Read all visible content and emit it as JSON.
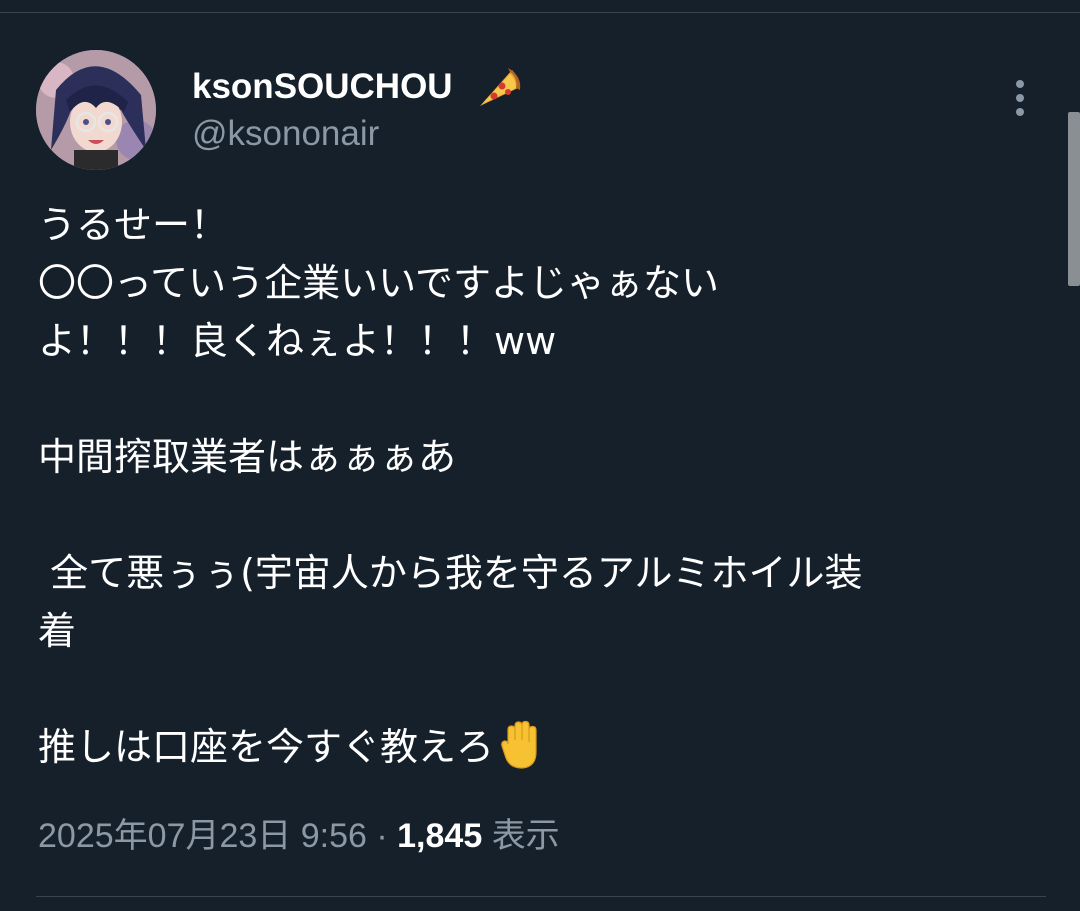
{
  "author": {
    "display_name": "ksonSOUCHOU",
    "handle": "@ksononair",
    "name_emoji_icon": "pizza-icon",
    "avatar": "anime-character-avatar"
  },
  "tweet": {
    "lines": [
      "うるせー！",
      "〇〇っていう企業いいですよじゃぁない",
      "よ！！！良くねぇよ！！！ww",
      "",
      "中間搾取業者はぁぁぁあ",
      "",
      " 全て悪ぅぅ(宇宙人から我を守るアルミホイル装",
      "着",
      "",
      "推しは口座を今すぐ教えろ"
    ],
    "trailing_emoji_icon": "raised-hand-icon"
  },
  "meta": {
    "timestamp": "2025年07月23日 9:56",
    "separator": "·",
    "views_count": "1,845",
    "views_label": "表示"
  },
  "colors": {
    "background": "#15202b",
    "text_primary": "#ffffff",
    "text_secondary": "#8b98a5",
    "divider": "#38444d"
  }
}
